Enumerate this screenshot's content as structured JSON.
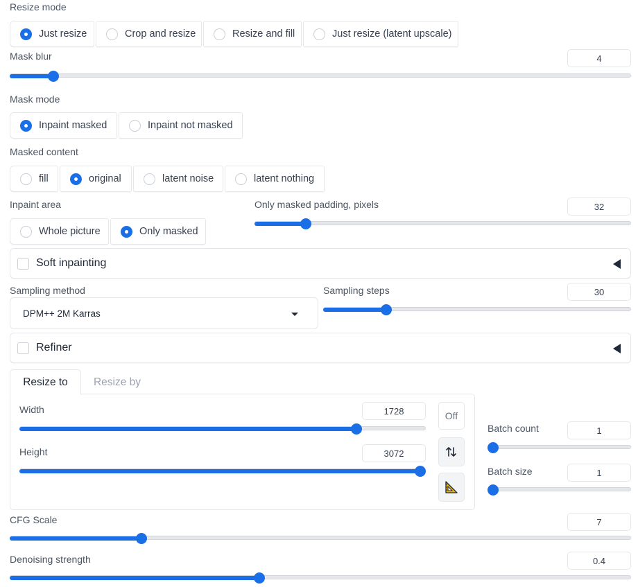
{
  "resize_mode": {
    "label": "Resize mode",
    "options": [
      "Just resize",
      "Crop and resize",
      "Resize and fill",
      "Just resize (latent upscale)"
    ],
    "selected": "Just resize"
  },
  "mask_blur": {
    "label": "Mask blur",
    "value": "4",
    "min": 0,
    "max": 64,
    "current": 4
  },
  "mask_mode": {
    "label": "Mask mode",
    "options": [
      "Inpaint masked",
      "Inpaint not masked"
    ],
    "selected": "Inpaint masked"
  },
  "masked_content": {
    "label": "Masked content",
    "options": [
      "fill",
      "original",
      "latent noise",
      "latent nothing"
    ],
    "selected": "original"
  },
  "inpaint_area": {
    "label": "Inpaint area",
    "options": [
      "Whole picture",
      "Only masked"
    ],
    "selected": "Only masked"
  },
  "only_masked_padding": {
    "label": "Only masked padding, pixels",
    "value": "32",
    "min": 0,
    "max": 256,
    "current": 32
  },
  "soft_inpainting": {
    "title": "Soft inpainting",
    "checked": false
  },
  "sampling_method": {
    "label": "Sampling method",
    "value": "DPM++ 2M Karras"
  },
  "sampling_steps": {
    "label": "Sampling steps",
    "value": "30",
    "min": 1,
    "max": 150,
    "current": 30
  },
  "refiner": {
    "title": "Refiner",
    "checked": false
  },
  "size_tabs": {
    "tabs": [
      "Resize to",
      "Resize by"
    ],
    "active": "Resize to"
  },
  "width": {
    "label": "Width",
    "value": "1728",
    "min": 64,
    "max": 2048,
    "current": 1728
  },
  "height": {
    "label": "Height",
    "value": "3072",
    "min": 64,
    "max": 3072,
    "current": 3072
  },
  "tools": {
    "off_label": "Off",
    "swap_icon": "swap-arrows-icon",
    "ruler_icon": "triangle-ruler-icon"
  },
  "batch_count": {
    "label": "Batch count",
    "value": "1",
    "min": 1,
    "max": 100,
    "current": 1
  },
  "batch_size": {
    "label": "Batch size",
    "value": "1",
    "min": 1,
    "max": 8,
    "current": 1
  },
  "cfg_scale": {
    "label": "CFG Scale",
    "value": "7",
    "min": 1,
    "max": 30,
    "current": 7
  },
  "denoising_strength": {
    "label": "Denoising strength",
    "value": "0.4",
    "min": 0,
    "max": 1,
    "current": 0.4
  },
  "colors": {
    "accent": "#1a6fe6",
    "border": "#e5e7eb",
    "text": "#374151"
  }
}
